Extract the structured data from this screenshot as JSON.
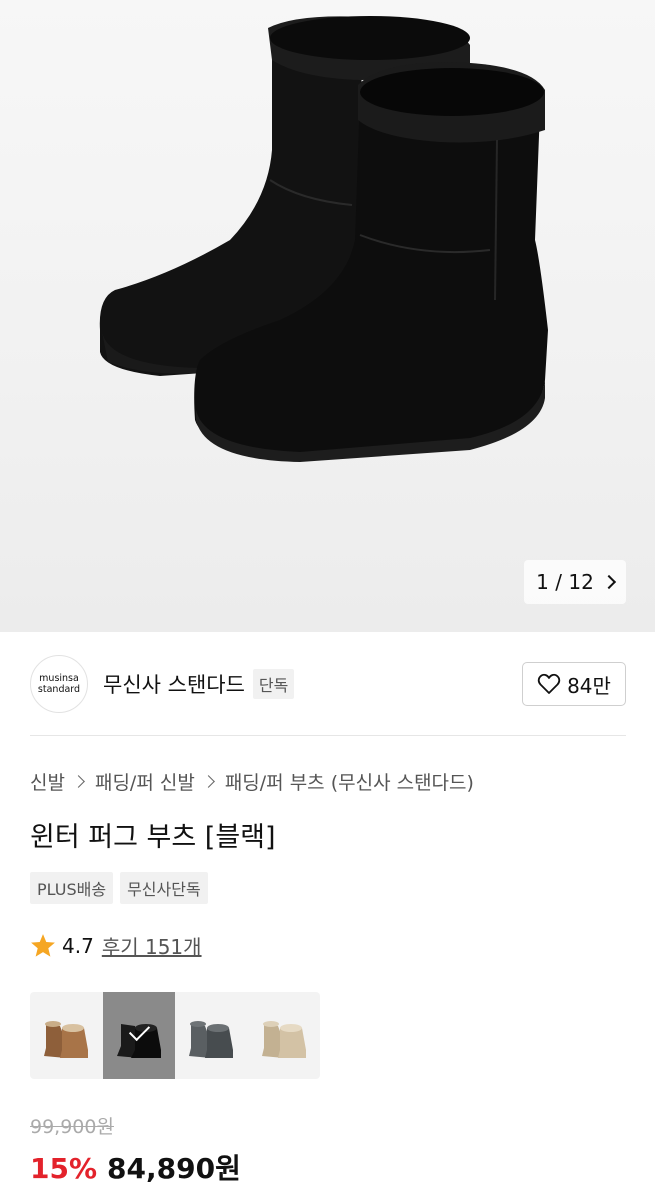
{
  "gallery": {
    "current": "1",
    "total": "12",
    "counter_text": "1 / 12"
  },
  "brand": {
    "logo_line1": "musinsa",
    "logo_line2": "standard",
    "name": "무신사 스탠다드",
    "badge": "단독",
    "like_count": "84만"
  },
  "breadcrumb": [
    "신발",
    "패딩/퍼 신발",
    "패딩/퍼 부츠 (무신사 스탠다드)"
  ],
  "product": {
    "title": "윈터 퍼그 부츠 [블랙]",
    "tags": [
      "PLUS배송",
      "무신사단독"
    ],
    "rating": "4.7",
    "reviews": "후기 151개"
  },
  "colors": [
    {
      "name": "brown-boot",
      "hex": "#9b6b43",
      "selected": false
    },
    {
      "name": "black-boot",
      "hex": "#0e0e0e",
      "selected": true
    },
    {
      "name": "grey-boot",
      "hex": "#4e5356",
      "selected": false
    },
    {
      "name": "beige-boot",
      "hex": "#cdbb9f",
      "selected": false
    }
  ],
  "price": {
    "original": "99,900원",
    "discount": "15%",
    "sale": "84,890원"
  },
  "theme": {
    "accent_red": "#e3222b",
    "star": "#f5a623"
  }
}
